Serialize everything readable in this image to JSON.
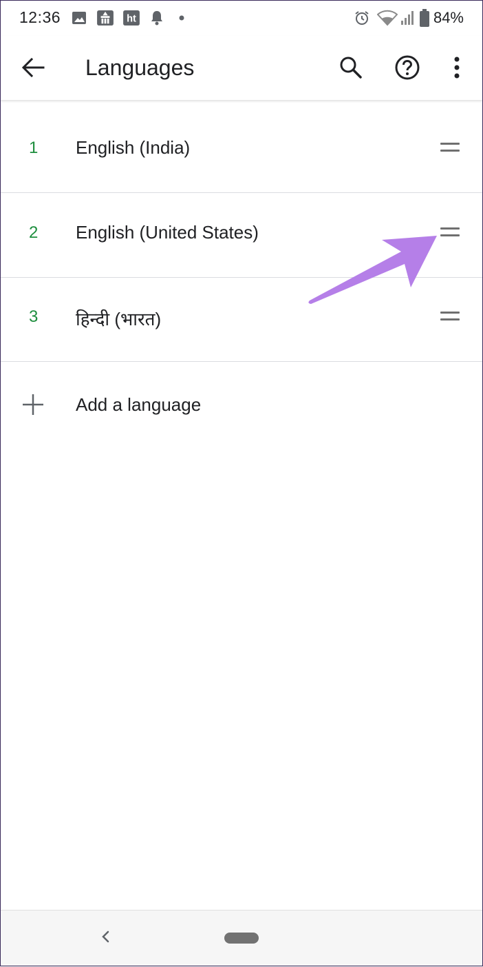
{
  "status_bar": {
    "time": "12:36",
    "notification_icons": [
      "image-icon",
      "temple-app-icon",
      "ht-app-icon",
      "bell-icon",
      "dot-icon"
    ],
    "ht_label": "ht",
    "system_icons": [
      "alarm-icon",
      "wifi-icon",
      "cellular-icon",
      "battery-icon"
    ],
    "battery": "84%"
  },
  "app_bar": {
    "title": "Languages",
    "actions": [
      "back-arrow-icon",
      "search-icon",
      "help-icon",
      "more-vert-icon"
    ]
  },
  "languages": [
    {
      "number": "1",
      "name": "English (India)"
    },
    {
      "number": "2",
      "name": "English (United States)"
    },
    {
      "number": "3",
      "name": "हिन्दी (भारत)"
    }
  ],
  "add_language": {
    "label": "Add a language"
  },
  "colors": {
    "number": "#1e8e3e",
    "annotation_arrow": "#b57fe8"
  }
}
